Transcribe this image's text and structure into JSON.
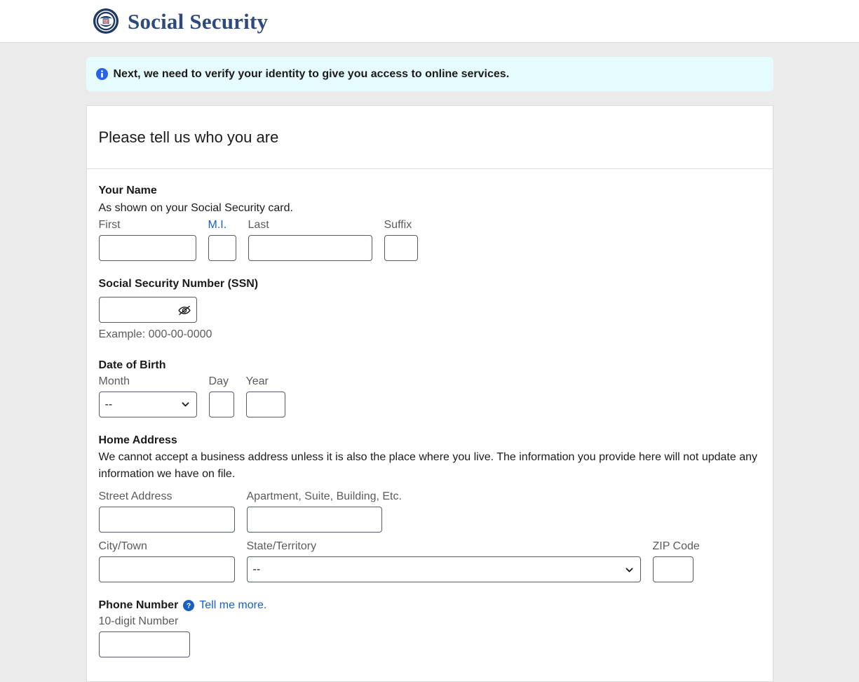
{
  "header": {
    "brand_name": "Social Security",
    "logo_icon": "ssa-seal-icon"
  },
  "alert": {
    "icon": "info-circle-icon",
    "message": "Next, we need to verify your identity to give you access to online services."
  },
  "card": {
    "title": "Please tell us who you are"
  },
  "form": {
    "name_section": {
      "legend": "Your Name",
      "hint": "As shown on your Social Security card.",
      "fields": [
        {
          "label": "First",
          "value": "",
          "name": "first-name-input"
        },
        {
          "label": "M.I.",
          "value": "",
          "name": "middle-initial-input"
        },
        {
          "label": "Last",
          "value": "",
          "name": "last-name-input"
        },
        {
          "label": "Suffix",
          "value": "",
          "name": "suffix-input"
        }
      ]
    },
    "ssn_section": {
      "legend": "Social Security Number (SSN)",
      "value": "",
      "toggle_icon": "eye-slash-icon",
      "example": "Example: 000-00-0000"
    },
    "dob_section": {
      "legend": "Date of Birth",
      "month_label": "Month",
      "month_value": "--",
      "month_options": [
        "--"
      ],
      "day_label": "Day",
      "day_value": "",
      "year_label": "Year",
      "year_value": ""
    },
    "address_section": {
      "legend": "Home Address",
      "hint": "We cannot accept a business address unless it is also the place where you live. The information you provide here will not update any information we have on file.",
      "street_label": "Street Address",
      "street_value": "",
      "apt_label": "Apartment, Suite, Building, Etc.",
      "apt_value": "",
      "city_label": "City/Town",
      "city_value": "",
      "state_label": "State/Territory",
      "state_value": "--",
      "state_options": [
        "--"
      ],
      "zip_label": "ZIP Code",
      "zip_value": ""
    },
    "phone_section": {
      "legend": "Phone Number",
      "help_icon": "question-circle-icon",
      "help_link": "Tell me more.",
      "number_label": "10-digit Number",
      "number_value": ""
    }
  },
  "colors": {
    "brand_navy": "#2e4a7d",
    "link_blue": "#1a5ec4",
    "accent_blue": "#2563eb",
    "alert_bg": "#e6fbfd",
    "page_bg": "#ebebeb",
    "input_border": "#565c65"
  }
}
